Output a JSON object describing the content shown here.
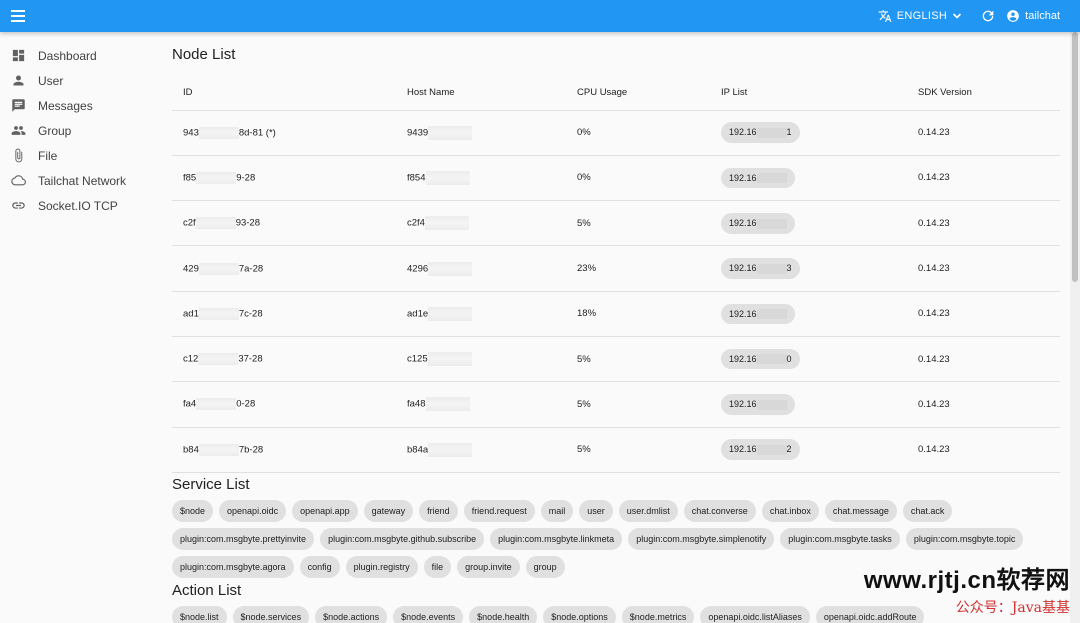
{
  "appbar": {
    "language": "ENGLISH",
    "username": "tailchat"
  },
  "sidebar": {
    "items": [
      {
        "label": "Dashboard",
        "icon": "dashboard-icon"
      },
      {
        "label": "User",
        "icon": "person-icon"
      },
      {
        "label": "Messages",
        "icon": "chat-icon"
      },
      {
        "label": "Group",
        "icon": "group-icon"
      },
      {
        "label": "File",
        "icon": "attachment-icon"
      },
      {
        "label": "Tailchat Network",
        "icon": "cloud-icon"
      },
      {
        "label": "Socket.IO TCP",
        "icon": "link-icon"
      }
    ]
  },
  "node_list": {
    "title": "Node List",
    "columns": [
      "ID",
      "Host Name",
      "CPU Usage",
      "IP List",
      "SDK Version"
    ],
    "rows": [
      {
        "id_start": "943",
        "id_end": "8d-81 (*)",
        "host": "9439",
        "cpu": "0%",
        "ip_start": "192.16",
        "ip_end": "1",
        "sdk": "0.14.23"
      },
      {
        "id_start": "f85",
        "id_end": "9-28",
        "host": "f854",
        "cpu": "0%",
        "ip_start": "192.16",
        "ip_end": "",
        "sdk": "0.14.23"
      },
      {
        "id_start": "c2f",
        "id_end": "93-28",
        "host": "c2f4",
        "cpu": "5%",
        "ip_start": "192.16",
        "ip_end": "",
        "sdk": "0.14.23"
      },
      {
        "id_start": "429",
        "id_end": "7a-28",
        "host": "4296",
        "cpu": "23%",
        "ip_start": "192.16",
        "ip_end": "3",
        "sdk": "0.14.23"
      },
      {
        "id_start": "ad1",
        "id_end": "7c-28",
        "host": "ad1e",
        "cpu": "18%",
        "ip_start": "192.16",
        "ip_end": "",
        "sdk": "0.14.23"
      },
      {
        "id_start": "c12",
        "id_end": "37-28",
        "host": "c125",
        "cpu": "5%",
        "ip_start": "192.16",
        "ip_end": "0",
        "sdk": "0.14.23"
      },
      {
        "id_start": "fa4",
        "id_end": "0-28",
        "host": "fa48",
        "cpu": "5%",
        "ip_start": "192.16",
        "ip_end": "",
        "sdk": "0.14.23"
      },
      {
        "id_start": "b84",
        "id_end": "7b-28",
        "host": "b84a",
        "cpu": "5%",
        "ip_start": "192.16",
        "ip_end": "2",
        "sdk": "0.14.23"
      }
    ]
  },
  "service_list": {
    "title": "Service List",
    "items": [
      "$node",
      "openapi.oidc",
      "openapi.app",
      "gateway",
      "friend",
      "friend.request",
      "mail",
      "user",
      "user.dmlist",
      "chat.converse",
      "chat.inbox",
      "chat.message",
      "chat.ack",
      "plugin:com.msgbyte.prettyinvite",
      "plugin:com.msgbyte.github.subscribe",
      "plugin:com.msgbyte.linkmeta",
      "plugin:com.msgbyte.simplenotify",
      "plugin:com.msgbyte.tasks",
      "plugin:com.msgbyte.topic",
      "plugin:com.msgbyte.agora",
      "config",
      "plugin.registry",
      "file",
      "group.invite",
      "group"
    ]
  },
  "action_list": {
    "title": "Action List",
    "items": [
      "$node.list",
      "$node.services",
      "$node.actions",
      "$node.events",
      "$node.health",
      "$node.options",
      "$node.metrics",
      "openapi.oidc.listAliases",
      "openapi.oidc.addRoute"
    ]
  },
  "watermark": {
    "line1": "www.rjtj.cn软荐网",
    "line2": "公众号：Java基基"
  },
  "colors": {
    "appbar": "#2196f3",
    "chip": "#e0e0e0",
    "background": "#fafafa"
  }
}
